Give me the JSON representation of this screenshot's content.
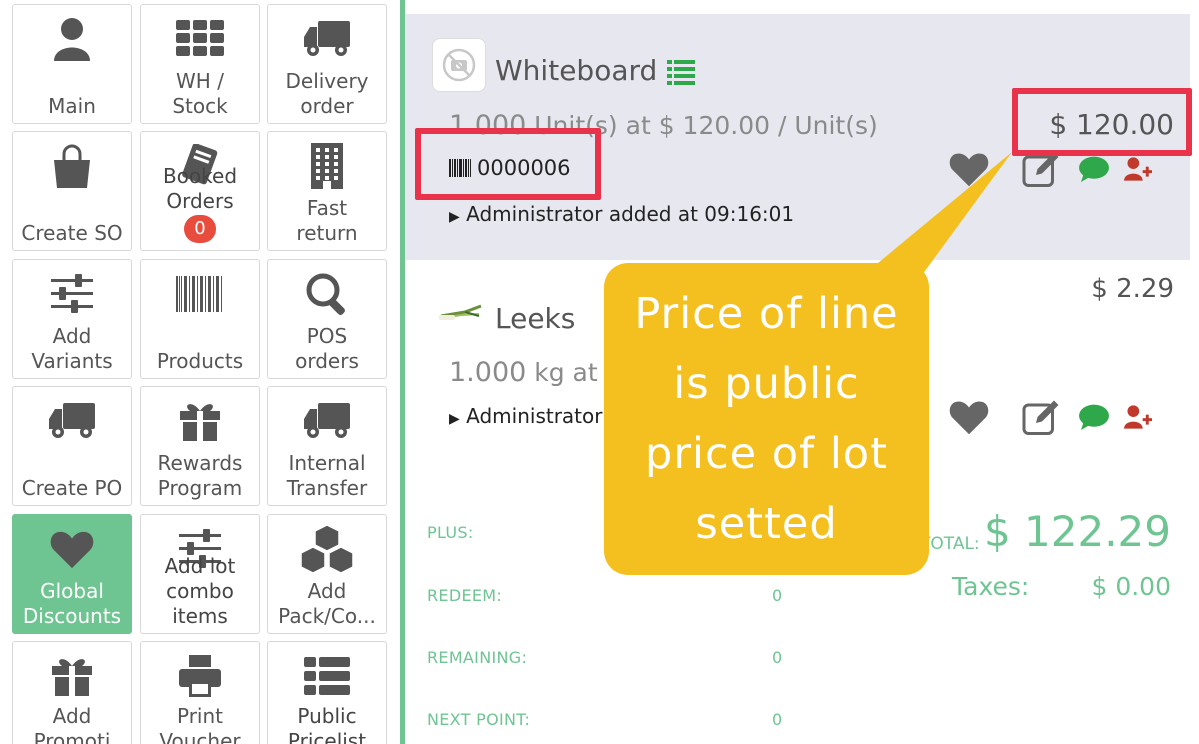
{
  "buttons": [
    {
      "id": "main",
      "label": "Main",
      "icon": "user-icon"
    },
    {
      "id": "wh-stock",
      "label": "WH /\nStock",
      "icon": "grid-icon"
    },
    {
      "id": "delivery-order",
      "label": "Delivery\norder",
      "icon": "truck-icon"
    },
    {
      "id": "create-so",
      "label": "Create SO",
      "icon": "shopping-bag-icon"
    },
    {
      "id": "booked-orders",
      "label": "Booked\nOrders",
      "icon": "book-icon",
      "badge": "0"
    },
    {
      "id": "fast-return",
      "label": "Fast\nreturn",
      "icon": "building-icon"
    },
    {
      "id": "add-variants",
      "label": "Add\nVariants",
      "icon": "sliders-icon"
    },
    {
      "id": "products",
      "label": "Products",
      "icon": "barcode-icon"
    },
    {
      "id": "pos-orders",
      "label": "POS\norders",
      "icon": "search-icon"
    },
    {
      "id": "create-po",
      "label": "Create PO",
      "icon": "truck-icon"
    },
    {
      "id": "rewards-program",
      "label": "Rewards\nProgram",
      "icon": "gift-icon"
    },
    {
      "id": "internal-transfer",
      "label": "Internal\nTransfer",
      "icon": "truck-icon"
    },
    {
      "id": "global-discounts",
      "label": "Global\nDiscounts",
      "icon": "heart-icon",
      "active": true
    },
    {
      "id": "add-lot-combo",
      "label": "Add lot\ncombo\nitems",
      "icon": "sliders-icon"
    },
    {
      "id": "add-pack",
      "label": "Add\nPack/Co...",
      "icon": "cubes-icon"
    },
    {
      "id": "add-promotion",
      "label": "Add\nPromoti",
      "icon": "gift-icon"
    },
    {
      "id": "print-voucher",
      "label": "Print\nVoucher",
      "icon": "printer-icon"
    },
    {
      "id": "public-pricelist",
      "label": "Public\nPricelist\n(USD)",
      "icon": "list-icon"
    }
  ],
  "order": {
    "lines": [
      {
        "name": "Whiteboard",
        "qty_number": "1.000",
        "qty_text": "Unit(s) at $ 120.00 / Unit(s)",
        "price": "$ 120.00",
        "lot": "0000006",
        "added_by": "Administrator added at 09:16:01"
      },
      {
        "name": "Leeks",
        "qty_number": "1.000",
        "qty_text": "kg at",
        "price": "$ 2.29",
        "added_by": "Administrator"
      }
    ],
    "summary": {
      "plus_label": "PLUS:",
      "redeem_label": "REDEEM:",
      "redeem_value": "0",
      "remaining_label": "REMAINING:",
      "remaining_value": "0",
      "next_point_label": "NEXT POINT:",
      "next_point_value": "0",
      "total_label": "TOTAL:",
      "total_value": "$ 122.29",
      "taxes_label": "Taxes:",
      "taxes_value": "$ 0.00"
    }
  },
  "callout": {
    "text": "Price of line is public price of lot setted"
  },
  "colors": {
    "accent_green": "#6ec592",
    "highlight_red": "#e8334a",
    "callout_yellow": "#f4c020"
  }
}
